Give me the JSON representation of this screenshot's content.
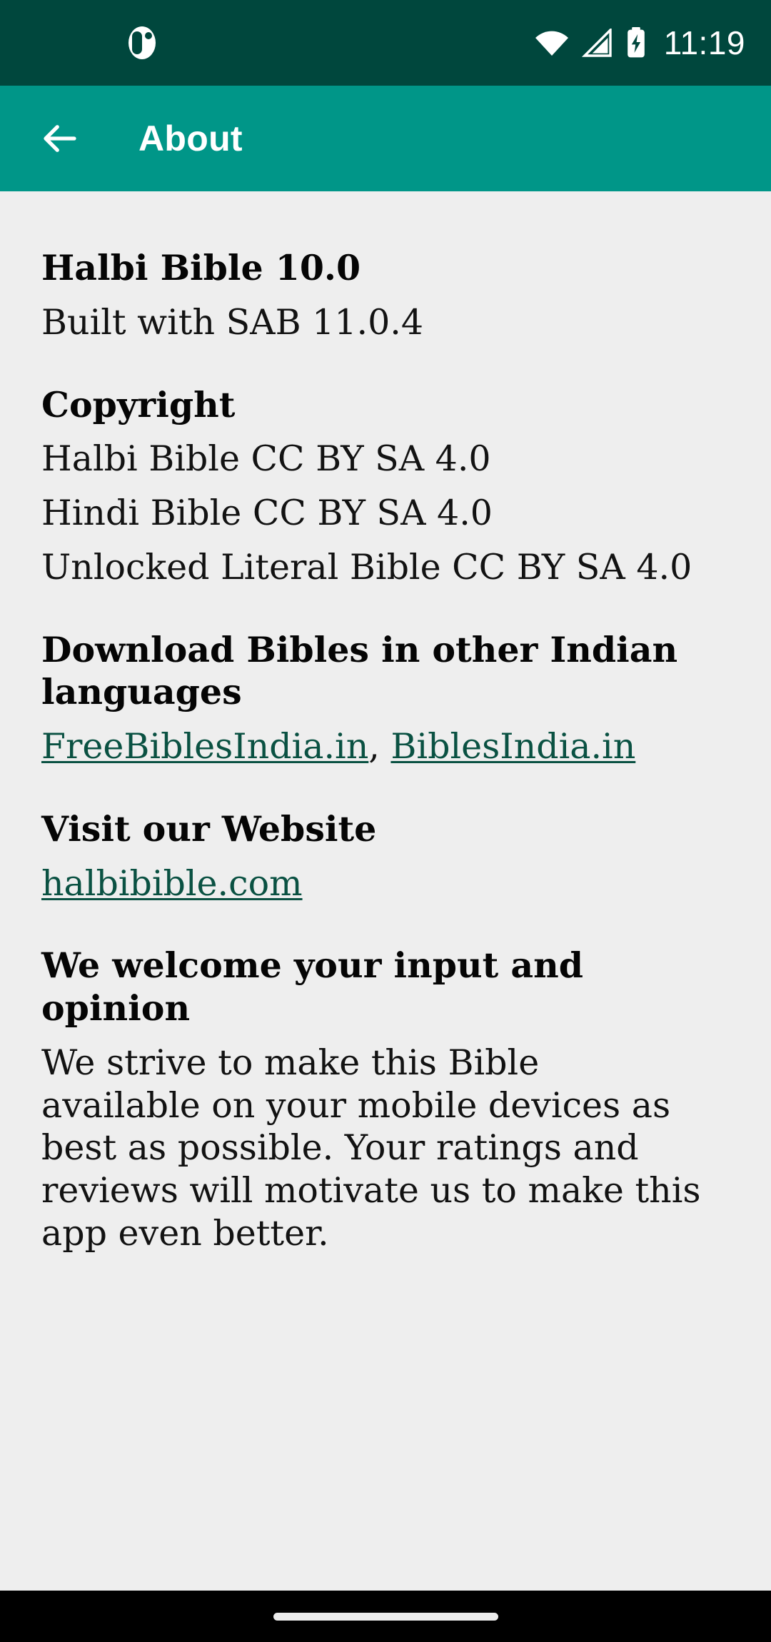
{
  "status_bar": {
    "notification_icon": "app-notification-icon",
    "wifi_icon": "wifi-icon",
    "signal_icon": "cellular-signal-icon",
    "battery_icon": "battery-charging-icon",
    "time": "11:19",
    "background_color": "#00473d"
  },
  "app_bar": {
    "back_icon": "back-arrow-icon",
    "title": "About",
    "background_color": "#009688"
  },
  "content": {
    "background_color": "#eeeeee",
    "app_title": "Halbi Bible 10.0",
    "built_with": "Built with SAB 11.0.4",
    "copyright": {
      "heading": "Copyright",
      "lines": [
        "Halbi Bible CC BY SA 4.0",
        "Hindi Bible CC BY SA 4.0",
        "Unlocked Literal Bible CC BY SA 4.0"
      ]
    },
    "download": {
      "heading": "Download Bibles in other Indian languages",
      "link_1": "FreeBiblesIndia.in",
      "separator": ", ",
      "link_2": "BiblesIndia.in"
    },
    "website": {
      "heading": "Visit our Website",
      "link": "halbibible.com"
    },
    "feedback": {
      "heading": "We welcome your input and opinion",
      "body": "We strive to make this Bible available on your mobile devices as best as possible. Your ratings and reviews will motivate us to make this app even better."
    },
    "link_color": "#0a5142"
  },
  "nav_bar": {
    "gesture_pill": "home-gesture-pill",
    "background_color": "#000000"
  }
}
